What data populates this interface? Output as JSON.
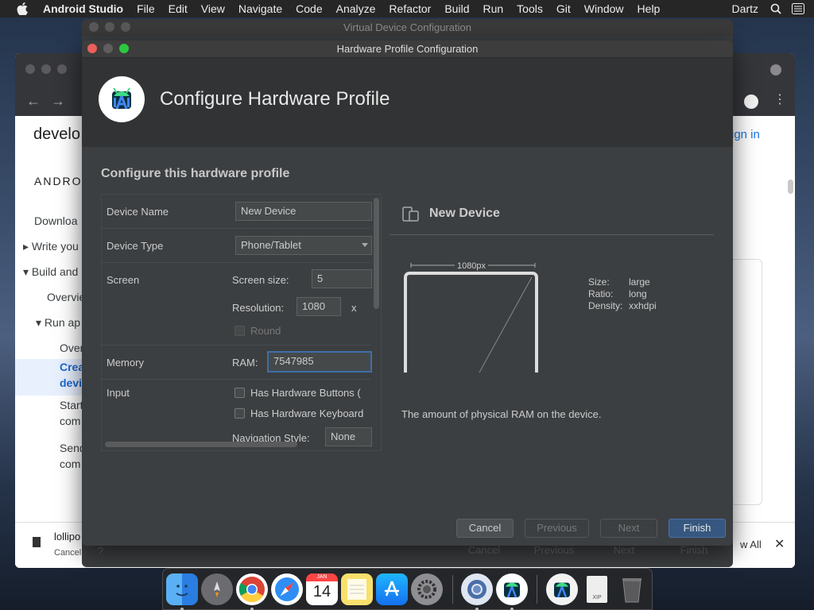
{
  "menubar": {
    "app_name": "Android Studio",
    "menus": [
      "File",
      "Edit",
      "View",
      "Navigate",
      "Code",
      "Analyze",
      "Refactor",
      "Build",
      "Run",
      "Tools",
      "Git",
      "Window",
      "Help"
    ],
    "user": "Dartz"
  },
  "browser": {
    "brand": "develo",
    "sign_in": "ign in",
    "section": "ANDRO",
    "sidebar": [
      "Downloa",
      "Write you",
      "Build and",
      "Overvie",
      "Run ap",
      "Over",
      "Crea",
      "devi",
      "Start",
      "com",
      "Send",
      "com"
    ],
    "download": {
      "file": "lollipo",
      "cancel": "Cancel",
      "show_all": "w All"
    }
  },
  "back_dialog": {
    "title": "Virtual Device Configuration",
    "buttons": [
      "Cancel",
      "Previous",
      "Next",
      "Finish"
    ]
  },
  "dialog": {
    "window_title": "Hardware Profile Configuration",
    "header_title": "Configure Hardware Profile",
    "section_title": "Configure this hardware profile",
    "colors": {
      "close": "#ec5f5a",
      "minimize": "#5e5e5e",
      "zoom": "#2bc840",
      "accent": "#3d6fa8",
      "primary_btn": "#365880"
    },
    "form": {
      "device_name_label": "Device Name",
      "device_name_value": "New Device",
      "device_type_label": "Device Type",
      "device_type_value": "Phone/Tablet",
      "screen_label": "Screen",
      "screen_size_label": "Screen size:",
      "screen_size_value": "5",
      "resolution_label": "Resolution:",
      "resolution_value": "1080",
      "resolution_sep": "x",
      "round_label": "Round",
      "memory_label": "Memory",
      "ram_label": "RAM:",
      "ram_value": "7547985",
      "input_label": "Input",
      "hw_buttons_label": "Has Hardware Buttons (",
      "hw_keyboard_label": "Has Hardware Keyboard",
      "nav_style_label": "Navigation Style:",
      "nav_style_value": "None"
    },
    "preview": {
      "device_name": "New Device",
      "width_label": "1080px",
      "size_key": "Size:",
      "size_val": "large",
      "ratio_key": "Ratio:",
      "ratio_val": "long",
      "density_key": "Density:",
      "density_val": "xxhdpi"
    },
    "description": "The amount of physical RAM on the device.",
    "buttons": {
      "cancel": "Cancel",
      "previous": "Previous",
      "next": "Next",
      "finish": "Finish"
    }
  },
  "dock": {
    "calendar_month": "JAN",
    "calendar_day": "14",
    "zip_label": "XIP"
  }
}
